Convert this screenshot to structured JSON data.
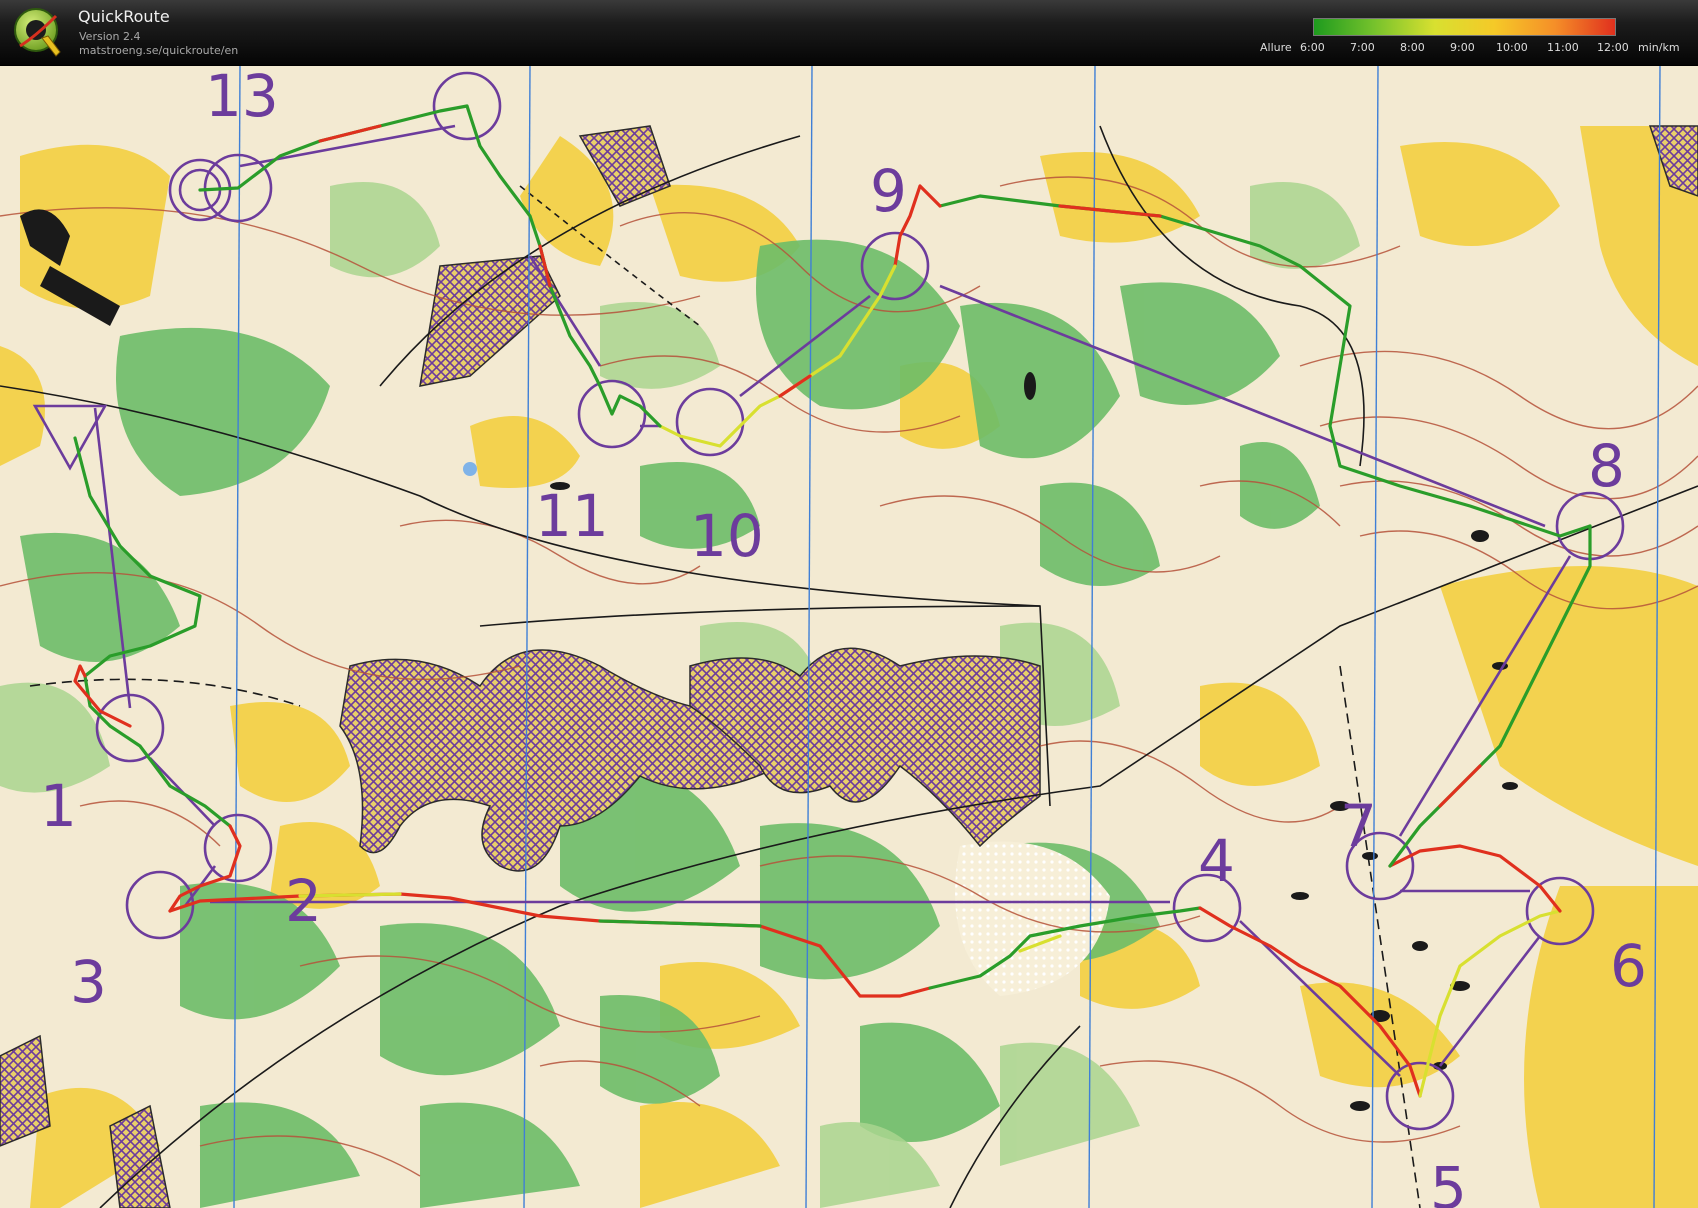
{
  "app": {
    "title": "QuickRoute",
    "version": "Version 2.4",
    "url": "matstroeng.se/quickroute/en"
  },
  "legend": {
    "label": "Allure",
    "ticks": [
      "6:00",
      "7:00",
      "8:00",
      "9:00",
      "10:00",
      "11:00",
      "12:00"
    ],
    "unit": "min/km",
    "colors": [
      "#1e9b1e",
      "#76c22c",
      "#d8e030",
      "#f5c928",
      "#f58f28",
      "#e0301e"
    ]
  },
  "map": {
    "controls": [
      {
        "label": "1"
      },
      {
        "label": "2"
      },
      {
        "label": "3"
      },
      {
        "label": "4"
      },
      {
        "label": "5"
      },
      {
        "label": "6"
      },
      {
        "label": "7"
      },
      {
        "label": "8"
      },
      {
        "label": "9"
      },
      {
        "label": "10"
      },
      {
        "label": "11"
      },
      {
        "label": "13"
      }
    ],
    "colors": {
      "open_land": "#f3d24f",
      "forest_green": "#6dbd68",
      "light_green": "#a9d58f",
      "background": "#f3ead2",
      "course_purple": "#6c3c9c",
      "contour_brown": "#b5523a",
      "north_lines": "#3f7fd6"
    }
  }
}
